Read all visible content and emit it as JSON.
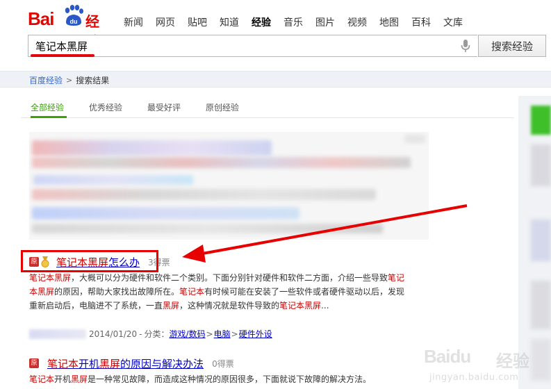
{
  "logo": {
    "bai": "Bai",
    "du": "du",
    "jingyan": "经验"
  },
  "nav": [
    {
      "label": "新闻",
      "active": false
    },
    {
      "label": "网页",
      "active": false
    },
    {
      "label": "贴吧",
      "active": false
    },
    {
      "label": "知道",
      "active": false
    },
    {
      "label": "经验",
      "active": true
    },
    {
      "label": "音乐",
      "active": false
    },
    {
      "label": "图片",
      "active": false
    },
    {
      "label": "视频",
      "active": false
    },
    {
      "label": "地图",
      "active": false
    },
    {
      "label": "百科",
      "active": false
    },
    {
      "label": "文库",
      "active": false
    }
  ],
  "search": {
    "value": "笔记本黑屏",
    "button": "搜索经验",
    "mic_icon": "microphone-icon"
  },
  "breadcrumb": {
    "home": "百度经验",
    "sep": ">",
    "current": "搜索结果"
  },
  "tabs": [
    {
      "label": "全部经验",
      "active": true
    },
    {
      "label": "优秀经验",
      "active": false
    },
    {
      "label": "最受好评",
      "active": false
    },
    {
      "label": "原创经验",
      "active": false
    }
  ],
  "results": [
    {
      "badge": "原",
      "title_em": "笔记本黑屏",
      "title_rest": "怎么办",
      "votes": "3得票",
      "abstract": [
        {
          "t": "笔记本黑屏",
          "em": true
        },
        {
          "t": "，大概可以分为硬件和软件二个类别。下面分别针对硬件和软件二方面，介绍一些导致",
          "em": false
        },
        {
          "t": "笔记本黑屏",
          "em": true
        },
        {
          "t": "的原因，帮助大家找出故障所在。",
          "em": false
        },
        {
          "t": "笔记本",
          "em": true
        },
        {
          "t": "有时候可能在安装了一些软件或者硬件驱动以后，发现重新启动后，电脑进不了系统，一直",
          "em": false
        },
        {
          "t": "黑屏",
          "em": true
        },
        {
          "t": "，这种情况就是软件导致的",
          "em": false
        },
        {
          "t": "笔记本黑屏",
          "em": true
        },
        {
          "t": "...",
          "em": false
        }
      ],
      "date": "2014/01/20",
      "category_label": "分类：",
      "categories": [
        "游戏/数码",
        "电脑",
        "硬件外设"
      ]
    },
    {
      "badge": "原",
      "title_parts": [
        {
          "t": "笔记本",
          "em": true
        },
        {
          "t": "开机",
          "em": false
        },
        {
          "t": "黑屏",
          "em": true
        },
        {
          "t": "的原因与解决办法",
          "em": false
        }
      ],
      "votes": "0得票",
      "abstract": [
        {
          "t": "笔记本",
          "em": true
        },
        {
          "t": "开机",
          "em": false
        },
        {
          "t": "黑屏",
          "em": true
        },
        {
          "t": "是一种常见故障，而造成这种情况的原因很多，下面就说下故障的解决方法。",
          "em": false
        }
      ]
    }
  ],
  "watermark": {
    "logo": "Baidu",
    "jingyan": "经验",
    "url": "jingyan.baidu.com"
  },
  "colors": {
    "brand_red": "#e10602",
    "link_blue": "#0000cc",
    "highlight_red": "#c00",
    "tab_green": "#38a400"
  }
}
